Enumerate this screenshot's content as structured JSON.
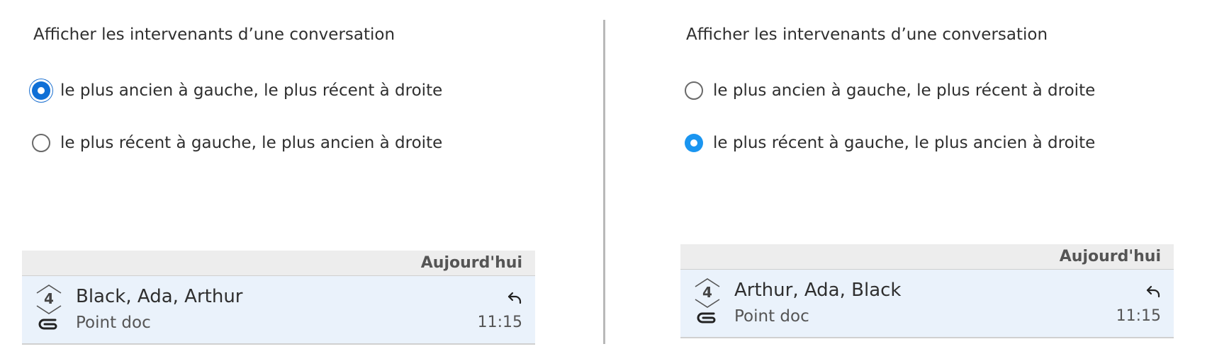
{
  "panels": [
    {
      "setting_title": "Afficher les intervenants d’une conversation",
      "options": [
        {
          "label": "le plus ancien à gauche, le plus récent à droite",
          "checked": true,
          "focused": true
        },
        {
          "label": "le plus récent à gauche, le plus ancien à droite",
          "checked": false,
          "focused": false
        }
      ],
      "preview": {
        "date_header": "Aujourd'hui",
        "message_count": "4",
        "participants": "Black, Ada, Arthur",
        "subject": "Point doc",
        "time": "11:15",
        "icons": [
          "conversation-count-icon",
          "attachment-icon",
          "reply-icon"
        ]
      }
    },
    {
      "setting_title": "Afficher les intervenants d’une conversation",
      "options": [
        {
          "label": "le plus ancien à gauche, le plus récent à droite",
          "checked": false,
          "focused": false
        },
        {
          "label": "le plus récent à gauche, le plus ancien à droite",
          "checked": true,
          "focused": false
        }
      ],
      "preview": {
        "date_header": "Aujourd'hui",
        "message_count": "4",
        "participants": "Arthur, Ada, Black",
        "subject": "Point doc",
        "time": "11:15",
        "icons": [
          "conversation-count-icon",
          "attachment-icon",
          "reply-icon"
        ]
      }
    }
  ],
  "colors": {
    "radio_checked": "#1a95f0",
    "radio_focus": "#0f6fd6",
    "row_background": "#eaf2fb",
    "header_background": "#ededed",
    "divider": "#b9b9b9"
  }
}
